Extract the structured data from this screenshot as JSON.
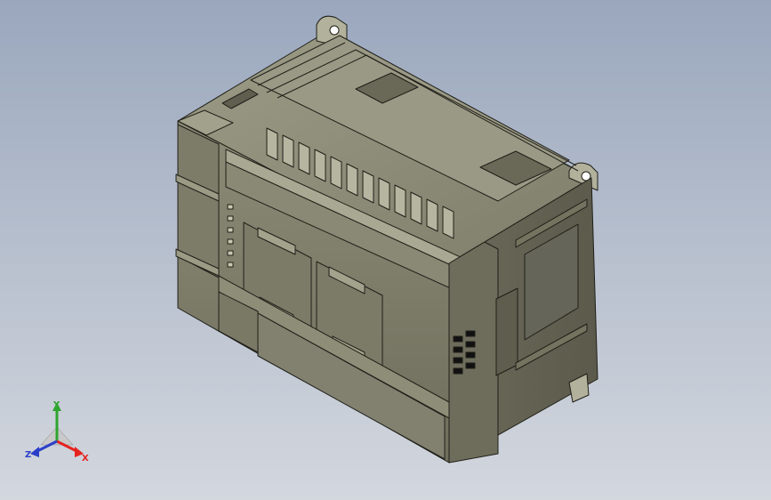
{
  "viewport": {
    "background_top": "#9aa7bd",
    "background_bottom": "#d3d7de"
  },
  "model": {
    "name": "plc-cpu-module",
    "body_color": "#807f6c",
    "edge_color": "#1f1f18"
  },
  "triad": {
    "x_label": "X",
    "y_label": "Y",
    "z_label": "Z",
    "x_color": "#e52420",
    "y_color": "#2fa52f",
    "z_color": "#2b3fc9"
  }
}
